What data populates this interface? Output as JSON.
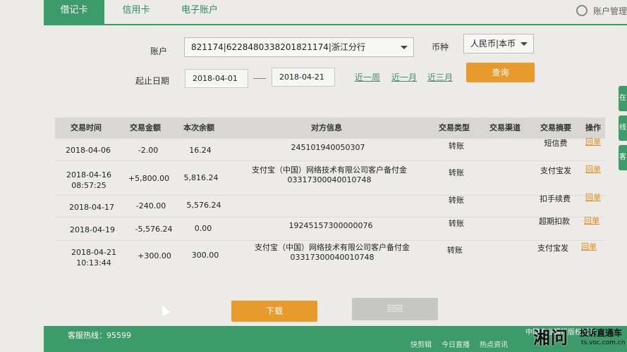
{
  "tabs": {
    "debit": "借记卡",
    "credit": "信用卡",
    "electronic": "电子账户"
  },
  "account_management": "账户管理",
  "filters": {
    "account_label": "账户",
    "account_value": "821174|6228480338201821174|浙江分行",
    "currency_label": "币种",
    "currency_value": "人民币|本币",
    "date_label": "起止日期",
    "start_date": "2018-04-01",
    "end_date": "2018-04-21",
    "quick_week": "近一周",
    "quick_month": "近一月",
    "quick_3months": "近三月",
    "query": "查询"
  },
  "table": {
    "headers": [
      "交易时间",
      "交易金额",
      "本次余额",
      "对方信息",
      "交易类型",
      "交易渠道",
      "交易摘要",
      "操作"
    ],
    "rows": [
      {
        "time1": "2018-04-06",
        "time2": "",
        "amount": "-2.00",
        "balance": "16.24",
        "counterparty1": "245101940050307",
        "counterparty2": "",
        "type": "转账",
        "channel": "",
        "summary": "短信费",
        "action": "回单"
      },
      {
        "time1": "2018-04-16",
        "time2": "08:57:25",
        "amount": "+5,800.00",
        "balance": "5,816.24",
        "counterparty1": "支付宝（中国）网络技术有限公司客户备付金",
        "counterparty2": "03317300040010748",
        "type": "转账",
        "channel": "",
        "summary": "支付宝发",
        "action": "回单"
      },
      {
        "time1": "2018-04-17",
        "time2": "",
        "amount": "-240.00",
        "balance": "5,576.24",
        "counterparty1": "",
        "counterparty2": "",
        "type": "转账",
        "channel": "",
        "summary": "扣手续费",
        "action": "回单"
      },
      {
        "time1": "2018-04-19",
        "time2": "",
        "amount": "-5,576.24",
        "balance": "0.00",
        "counterparty1": "19245157300000076",
        "counterparty2": "",
        "type": "转账",
        "channel": "",
        "summary": "超期扣款",
        "action": "回单"
      },
      {
        "time1": "2018-04-21",
        "time2": "10:13:44",
        "amount": "+300.00",
        "balance": "300.00",
        "counterparty1": "支付宝（中国）网络技术有限公司客户备付金",
        "counterparty2": "03317300040010748",
        "type": "转账",
        "channel": "",
        "summary": "支付宝发",
        "action": "回单"
      }
    ]
  },
  "buttons": {
    "download": "下载",
    "receipt": "回回"
  },
  "footer": {
    "hotline": "客服热线：95599",
    "copyright": "中国农业银行版权所有",
    "items": [
      "快剪辑",
      "今日直播",
      "热点资讯"
    ]
  },
  "watermark": {
    "logo": "湘问",
    "text": "投诉直通车",
    "url": "ts.voc.com.cn"
  },
  "side_tabs": [
    "在",
    "线",
    "客"
  ],
  "colors": {
    "brand_green": "#3d9a6a",
    "accent_orange": "#e89a2c"
  }
}
